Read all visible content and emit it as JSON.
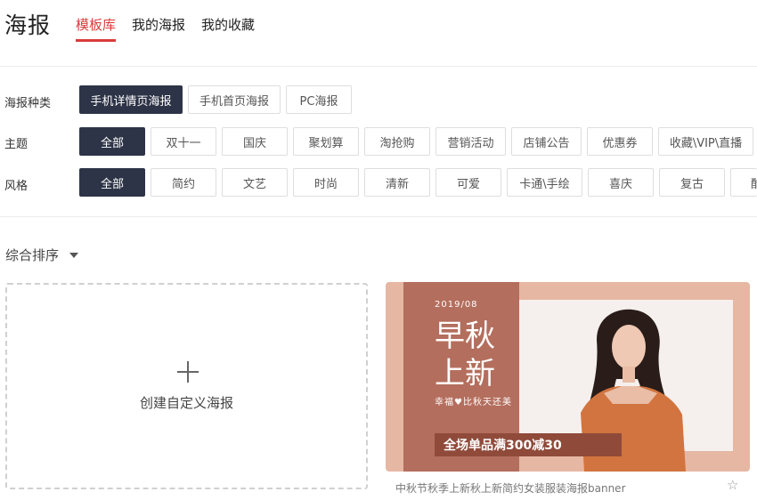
{
  "header": {
    "title": "海报",
    "tabs": [
      {
        "label": "模板库",
        "active": true
      },
      {
        "label": "我的海报",
        "active": false
      },
      {
        "label": "我的收藏",
        "active": false
      }
    ]
  },
  "filters": {
    "category": {
      "label": "海报种类",
      "options": [
        "手机详情页海报",
        "手机首页海报",
        "PC海报"
      ],
      "selected": "手机详情页海报"
    },
    "theme": {
      "label": "主题",
      "options": [
        "全部",
        "双十一",
        "国庆",
        "聚划算",
        "淘抢购",
        "营销活动",
        "店铺公告",
        "优惠券",
        "收藏\\VIP\\直播"
      ],
      "selected": "全部"
    },
    "style": {
      "label": "风格",
      "options": [
        "全部",
        "简约",
        "文艺",
        "时尚",
        "清新",
        "可爱",
        "卡通\\手绘",
        "喜庆",
        "复古",
        "酷"
      ],
      "selected": "全部"
    }
  },
  "sort": {
    "label": "综合排序"
  },
  "create_card": {
    "label": "创建自定义海报"
  },
  "templates": [
    {
      "date": "2019/08",
      "headline": "早秋\n上新",
      "slogan": "幸福♥比秋天还美",
      "banner": "全场单品满300减30",
      "caption": "中秋节秋季上新秋上新简约女装服装海报banner"
    }
  ],
  "colors": {
    "accent": "#d93b3b",
    "chip_active_bg": "#2e3447",
    "poster_bg": "#e6b7a3",
    "poster_band": "#b46e5d"
  }
}
